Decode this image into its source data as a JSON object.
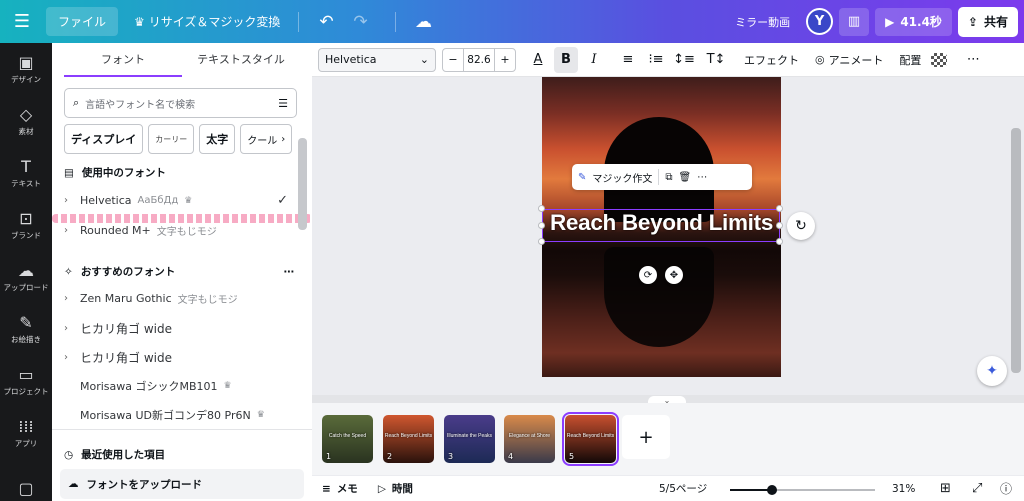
{
  "topbar": {
    "file_label": "ファイル",
    "resize_label": "リサイズ＆マジック変換",
    "mirror_label": "ミラー動画",
    "avatar_initial": "Y",
    "play_label": "41.4秒",
    "share_label": "共有"
  },
  "rail": [
    {
      "label": "デザイン",
      "icon": "design-icon"
    },
    {
      "label": "素材",
      "icon": "elements-icon"
    },
    {
      "label": "テキスト",
      "icon": "text-icon"
    },
    {
      "label": "ブランド",
      "icon": "brand-icon"
    },
    {
      "label": "アップロード",
      "icon": "upload-icon"
    },
    {
      "label": "お絵描き",
      "icon": "draw-icon"
    },
    {
      "label": "プロジェクト",
      "icon": "projects-icon"
    },
    {
      "label": "アプリ",
      "icon": "apps-icon"
    }
  ],
  "panel": {
    "tabs": [
      "フォント",
      "テキストスタイル"
    ],
    "search_placeholder": "言語やフォント名で検索",
    "filters": [
      "ディスプレイ",
      "カーリー",
      "太字",
      "クール"
    ],
    "in_use_title": "使用中のフォント",
    "in_use": [
      {
        "name": "Helvetica",
        "sample": "АаБбДд",
        "crown": true,
        "checked": true
      },
      {
        "name": "Rounded M+",
        "sample": "文字もじモジ",
        "crown": false,
        "checked": false
      }
    ],
    "recommended_title": "おすすめのフォント",
    "recommended": [
      {
        "name": "Zen Maru Gothic",
        "sample": "文字もじモジ",
        "chevron": true,
        "crown": false
      },
      {
        "name": "ヒカリ角ゴ wide",
        "sample": "",
        "chevron": true,
        "crown": false
      },
      {
        "name": "ヒカリ角ゴ wide",
        "sample": "",
        "chevron": true,
        "crown": false
      },
      {
        "name": "Morisawa ゴシックMB101",
        "sample": "",
        "chevron": false,
        "crown": true
      },
      {
        "name": "Morisawa UD新ゴコンデ80 Pr6N",
        "sample": "",
        "chevron": false,
        "crown": true
      }
    ],
    "recent_title": "最近使用した項目",
    "upload_label": "フォントをアップロード"
  },
  "toolbar": {
    "font_name": "Helvetica",
    "font_size": "82.6",
    "effects_label": "エフェクト",
    "animate_label": "アニメート",
    "position_label": "配置"
  },
  "canvas": {
    "headline": "Reach Beyond Limits",
    "magic_write_label": "マジック作文"
  },
  "pages": [
    {
      "num": "1",
      "title": "Catch the Speed",
      "colors": [
        "#5a6b3a",
        "#2a3320"
      ]
    },
    {
      "num": "2",
      "title": "Reach Beyond Limits",
      "colors": [
        "#d0572f",
        "#2a120c"
      ]
    },
    {
      "num": "3",
      "title": "Illuminate the Peaks",
      "colors": [
        "#4a3c8a",
        "#1d2a55"
      ]
    },
    {
      "num": "4",
      "title": "Elegance at Shore",
      "colors": [
        "#d98a4a",
        "#3a3a4a"
      ]
    },
    {
      "num": "5",
      "title": "Reach Beyond Limits",
      "colors": [
        "#c9502f",
        "#120807"
      ]
    }
  ],
  "bottombar": {
    "notes_label": "メモ",
    "timer_label": "時間",
    "page_count": "5/5ページ",
    "zoom": "31%",
    "zoom_fraction": 0.29
  },
  "colors": {
    "accent": "#8b3dff",
    "rail_bg": "#18191b"
  }
}
